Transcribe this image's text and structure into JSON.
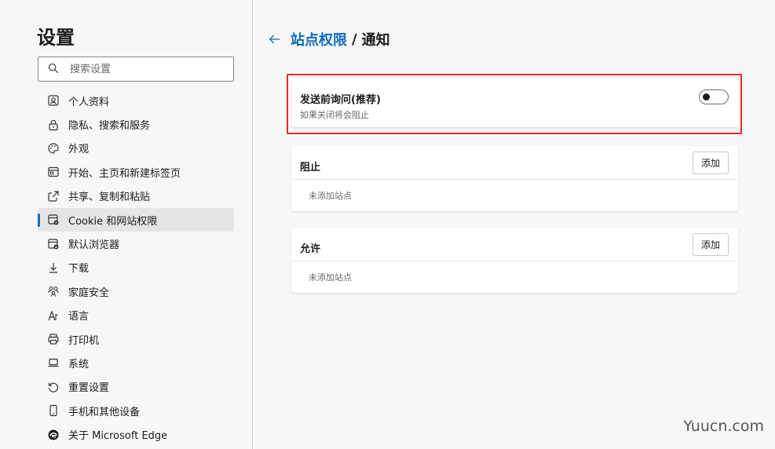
{
  "sidebar": {
    "title": "设置",
    "search_placeholder": "搜索设置",
    "items": [
      {
        "label": "个人资料",
        "icon": "profile-icon"
      },
      {
        "label": "隐私、搜索和服务",
        "icon": "lock-icon"
      },
      {
        "label": "外观",
        "icon": "palette-icon"
      },
      {
        "label": "开始、主页和新建标签页",
        "icon": "home-tab-icon"
      },
      {
        "label": "共享、复制和粘贴",
        "icon": "share-icon"
      },
      {
        "label": "Cookie 和网站权限",
        "icon": "site-permissions-icon",
        "active": true
      },
      {
        "label": "默认浏览器",
        "icon": "default-browser-icon"
      },
      {
        "label": "下载",
        "icon": "download-icon"
      },
      {
        "label": "家庭安全",
        "icon": "family-icon"
      },
      {
        "label": "语言",
        "icon": "language-icon"
      },
      {
        "label": "打印机",
        "icon": "printer-icon"
      },
      {
        "label": "系统",
        "icon": "laptop-icon"
      },
      {
        "label": "重置设置",
        "icon": "reset-icon"
      },
      {
        "label": "手机和其他设备",
        "icon": "phone-icon"
      },
      {
        "label": "关于 Microsoft Edge",
        "icon": "edge-icon"
      }
    ]
  },
  "header": {
    "parent": "站点权限",
    "separator": "/",
    "current": "通知"
  },
  "ask_card": {
    "title": "发送前询问(推荐)",
    "subtitle": "如果关闭将会阻止",
    "toggle_on": false
  },
  "block_card": {
    "title": "阻止",
    "add_label": "添加",
    "empty_text": "未添加站点"
  },
  "allow_card": {
    "title": "允许",
    "add_label": "添加",
    "empty_text": "未添加站点"
  },
  "watermark": "Yuucn.com",
  "colors": {
    "accent": "#0f6cbd",
    "highlight": "#e32b24",
    "background": "#f7f7f7"
  }
}
